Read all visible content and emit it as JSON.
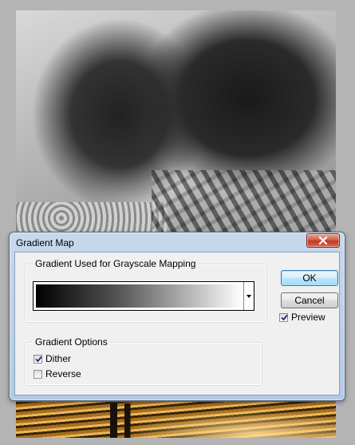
{
  "dialog": {
    "title": "Gradient Map",
    "gradient_group_label": "Gradient Used for Grayscale Mapping",
    "options_group_label": "Gradient Options",
    "options": [
      {
        "label": "Dither",
        "checked": true
      },
      {
        "label": "Reverse",
        "checked": false
      }
    ],
    "buttons": {
      "ok": "OK",
      "cancel": "Cancel"
    },
    "preview": {
      "label": "Preview",
      "checked": true
    },
    "gradient": {
      "from_color": "#000000",
      "to_color": "#ffffff"
    }
  },
  "icons": {
    "close": "close-icon",
    "dropdown": "chevron-down-icon",
    "check": "checkmark-icon"
  },
  "colors": {
    "title_bar": "#c7d8ec",
    "close_button": "#c0381f",
    "default_button": "#3c7fb1",
    "beach_sand": "#e9b758"
  }
}
